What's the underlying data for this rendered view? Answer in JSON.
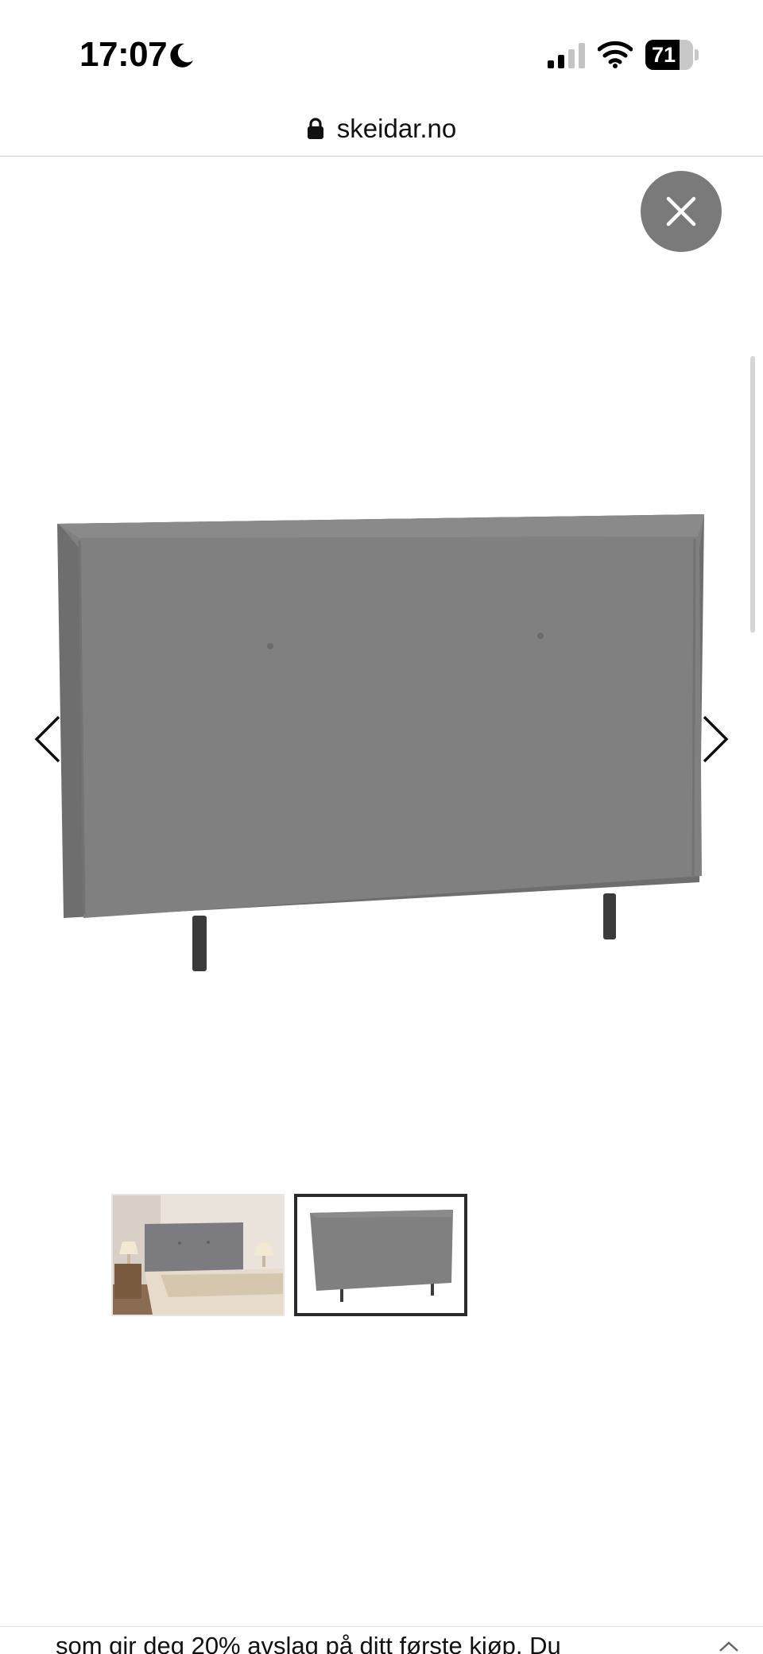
{
  "status_bar": {
    "time": "17:07",
    "focus_icon": "moon-icon",
    "signal_icon": "cellular-signal-icon",
    "wifi_icon": "wifi-icon",
    "battery_level": "71",
    "battery_fraction": 0.71
  },
  "browser": {
    "url": "skeidar.no",
    "lock_icon": "lock-icon"
  },
  "lightbox": {
    "close_icon": "close-icon",
    "prev_icon": "chevron-left-icon",
    "next_icon": "chevron-right-icon",
    "thumbnails": [
      {
        "name": "bedroom-photo",
        "selected": false
      },
      {
        "name": "headboard-photo",
        "selected": true
      }
    ],
    "product_color": "#808080"
  },
  "banner": {
    "text": "som gir deg 20% avslag på ditt første kjøp. Du"
  }
}
